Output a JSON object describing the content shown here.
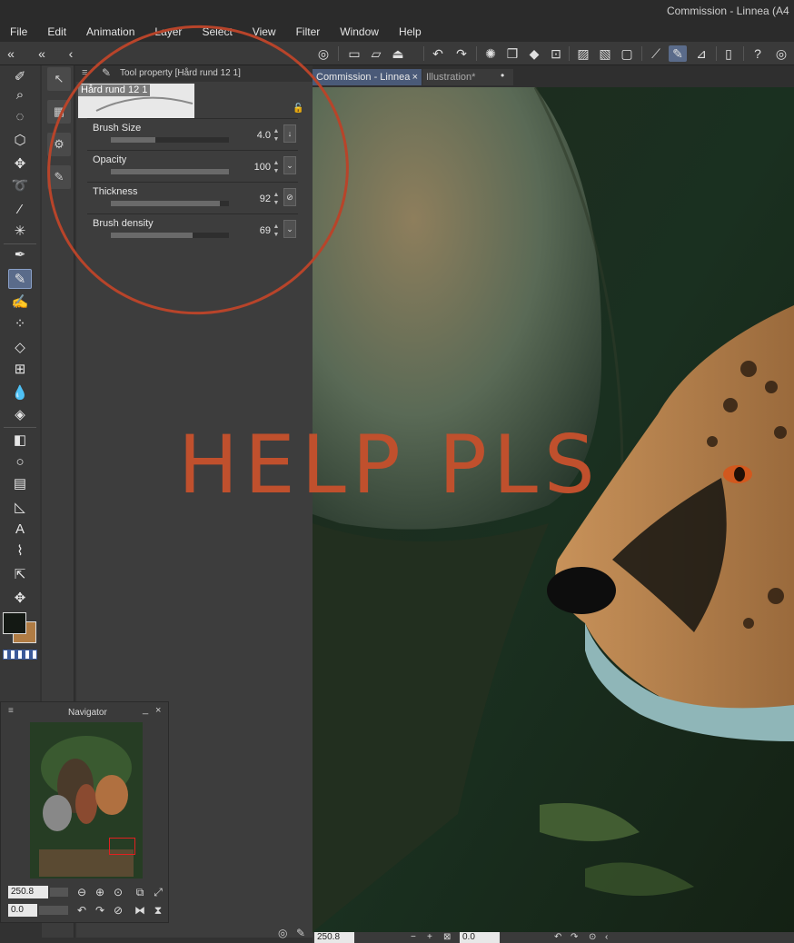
{
  "window": {
    "title": "Commission - Linnea (A4"
  },
  "menu": [
    "File",
    "Edit",
    "Animation",
    "Layer",
    "Select",
    "View",
    "Filter",
    "Window",
    "Help"
  ],
  "tool_property": {
    "title": "Tool property [Hård rund 12 1]",
    "brush_name": "Hård rund 12 1",
    "properties": [
      {
        "label": "Brush Size",
        "value": "4.0",
        "fraction": 0.38
      },
      {
        "label": "Opacity",
        "value": "100",
        "fraction": 1.0
      },
      {
        "label": "Thickness",
        "value": "92",
        "fraction": 0.92
      },
      {
        "label": "Brush density",
        "value": "69",
        "fraction": 0.69
      }
    ]
  },
  "tabs": [
    {
      "label": "Commission - Linnea",
      "active": true
    },
    {
      "label": "Illustration*",
      "active": false
    }
  ],
  "overlay": {
    "text": "HELP PLS",
    "color": "#c0502d"
  },
  "navigator": {
    "title": "Navigator",
    "zoom": "250.8",
    "rotation": "0.0"
  },
  "statusbar": {
    "zoom": "250.8",
    "rotation": "0.0"
  },
  "colors": {
    "main": "#141914",
    "sub": "#b07c44",
    "accent": "#5a6b8a"
  }
}
